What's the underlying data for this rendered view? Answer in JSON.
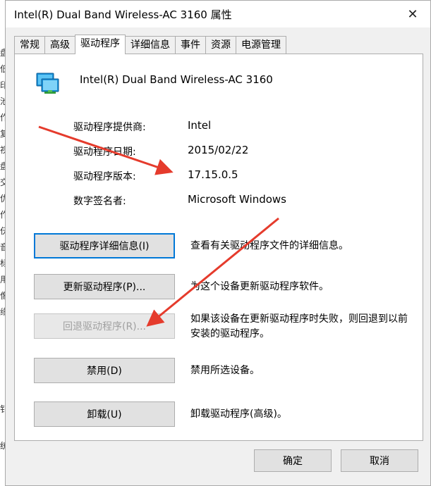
{
  "background": {
    "left_fragments": [
      "盘",
      "低",
      "印",
      "池",
      "作",
      "复",
      "视",
      "盘",
      "交",
      "仇",
      "作",
      "仸",
      "音",
      "标",
      "用",
      "像",
      "缘",
      "钅",
      "统"
    ]
  },
  "dialog": {
    "title": "Intel(R) Dual Band Wireless-AC 3160 属性",
    "close_glyph": "✕"
  },
  "tabs": [
    {
      "label": "常规",
      "active": false
    },
    {
      "label": "高级",
      "active": false
    },
    {
      "label": "驱动程序",
      "active": true
    },
    {
      "label": "详细信息",
      "active": false
    },
    {
      "label": "事件",
      "active": false
    },
    {
      "label": "资源",
      "active": false
    },
    {
      "label": "电源管理",
      "active": false
    }
  ],
  "device": {
    "icon": "network-adapter-icon",
    "name": "Intel(R) Dual Band Wireless-AC 3160"
  },
  "driver_info": [
    {
      "label": "驱动程序提供商:",
      "value": "Intel"
    },
    {
      "label": "驱动程序日期:",
      "value": "2015/02/22"
    },
    {
      "label": "驱动程序版本:",
      "value": "17.15.0.5"
    },
    {
      "label": "数字签名者:",
      "value": "Microsoft Windows"
    }
  ],
  "actions": [
    {
      "button": "驱动程序详细信息(I)",
      "description": "查看有关驱动程序文件的详细信息。",
      "state": "focused"
    },
    {
      "button": "更新驱动程序(P)...",
      "description": "为这个设备更新驱动程序软件。",
      "state": "normal"
    },
    {
      "button": "回退驱动程序(R)...",
      "description": "如果该设备在更新驱动程序时失败，则回退到以前安装的驱动程序。",
      "state": "disabled"
    },
    {
      "button": "禁用(D)",
      "description": "禁用所选设备。",
      "state": "normal"
    },
    {
      "button": "卸载(U)",
      "description": "卸载驱动程序(高级)。",
      "state": "normal"
    }
  ],
  "footer": {
    "ok": "确定",
    "cancel": "取消"
  },
  "colors": {
    "annotation_arrow": "#e53b2c",
    "focus_border": "#0078d7"
  }
}
